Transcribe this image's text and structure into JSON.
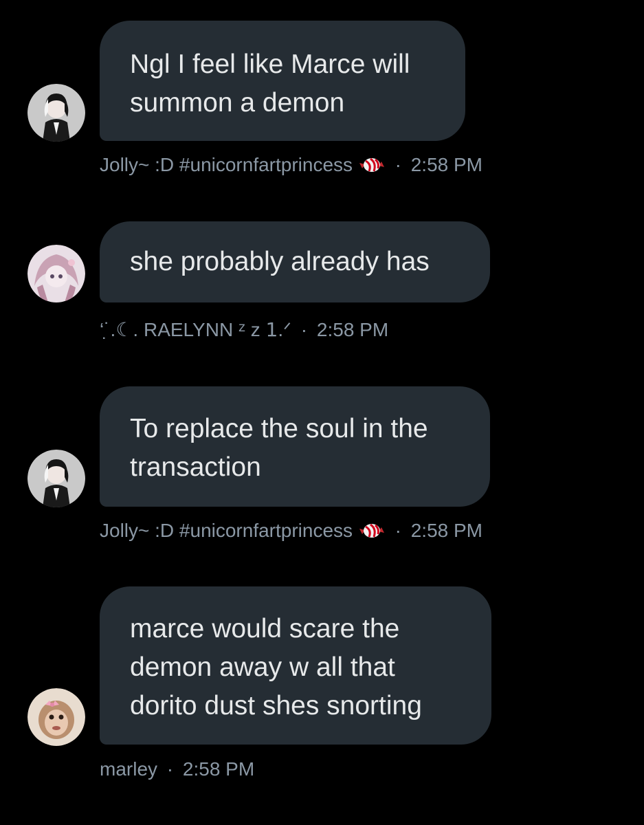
{
  "messages": [
    {
      "lines": [
        "Ngl I feel like Marce will",
        "summon a demon"
      ],
      "author": "Jolly~ :D #unicornfartprincess",
      "author_emoji": "candy-icon",
      "separator": "·",
      "time": "2:58 PM"
    },
    {
      "lines": [
        "she probably already has"
      ],
      "author": "‘˙̣.☾. RAELYNN ᶻ z 𝟣.ᐟ",
      "separator": "·",
      "time": "2:58 PM"
    },
    {
      "lines": [
        "To replace the soul in the",
        "transaction"
      ],
      "author": "Jolly~ :D #unicornfartprincess",
      "author_emoji": "candy-icon",
      "separator": "·",
      "time": "2:58 PM"
    },
    {
      "lines": [
        "marce would scare the",
        "demon away w all that",
        "dorito dust shes snorting"
      ],
      "author": "marley",
      "separator": "·",
      "time": "2:58 PM"
    }
  ],
  "colors": {
    "background": "#000000",
    "bubble": "#252d34",
    "text": "#e7e9ea",
    "meta": "#8b98a5"
  }
}
